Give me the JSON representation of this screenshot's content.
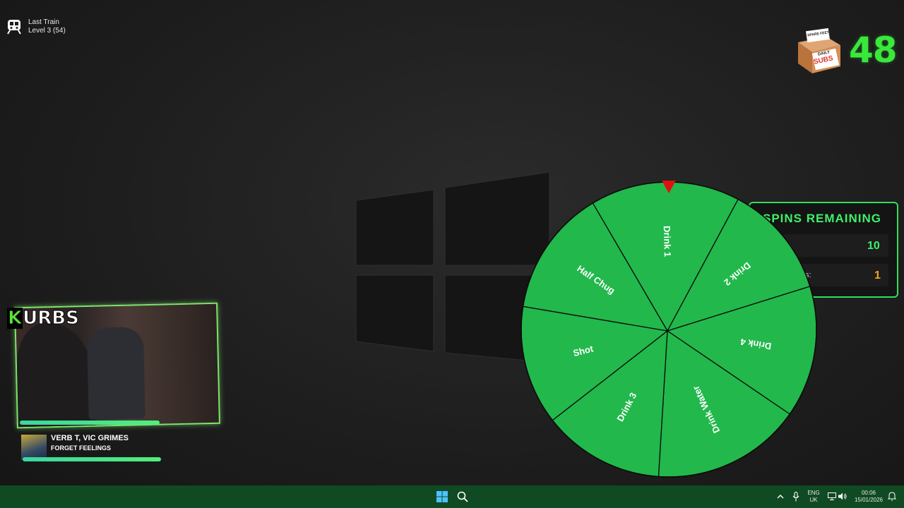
{
  "train": {
    "title": "Last Train",
    "level": "Level 3  (54)"
  },
  "daily_subs": {
    "box_label_top": "SPARE FEET?!",
    "box_label_daily": "DAILY",
    "box_label_subs": "SUBS",
    "count": "48"
  },
  "spins": {
    "title": "SPINS REMAINING",
    "row1_value": "10",
    "row2_label": "s:",
    "row2_value": "1"
  },
  "wheel": {
    "segments": [
      "Drink 1",
      "Drink 2",
      "Drink 4",
      "Drink Water",
      "Drink 3",
      "Shot",
      "Half Chug"
    ],
    "fill": "#22b84c",
    "pointer_color": "#e01010"
  },
  "webcam": {
    "channel_logo_k": "K",
    "channel_logo_rest": "URBS"
  },
  "now_playing": {
    "artist": "VERB T, VIC GRIMES",
    "title": "FORGET FEELINGS"
  },
  "taskbar": {
    "lang_top": "ENG",
    "lang_bottom": "UK",
    "time": "00:06",
    "date": "15/01/2026"
  }
}
